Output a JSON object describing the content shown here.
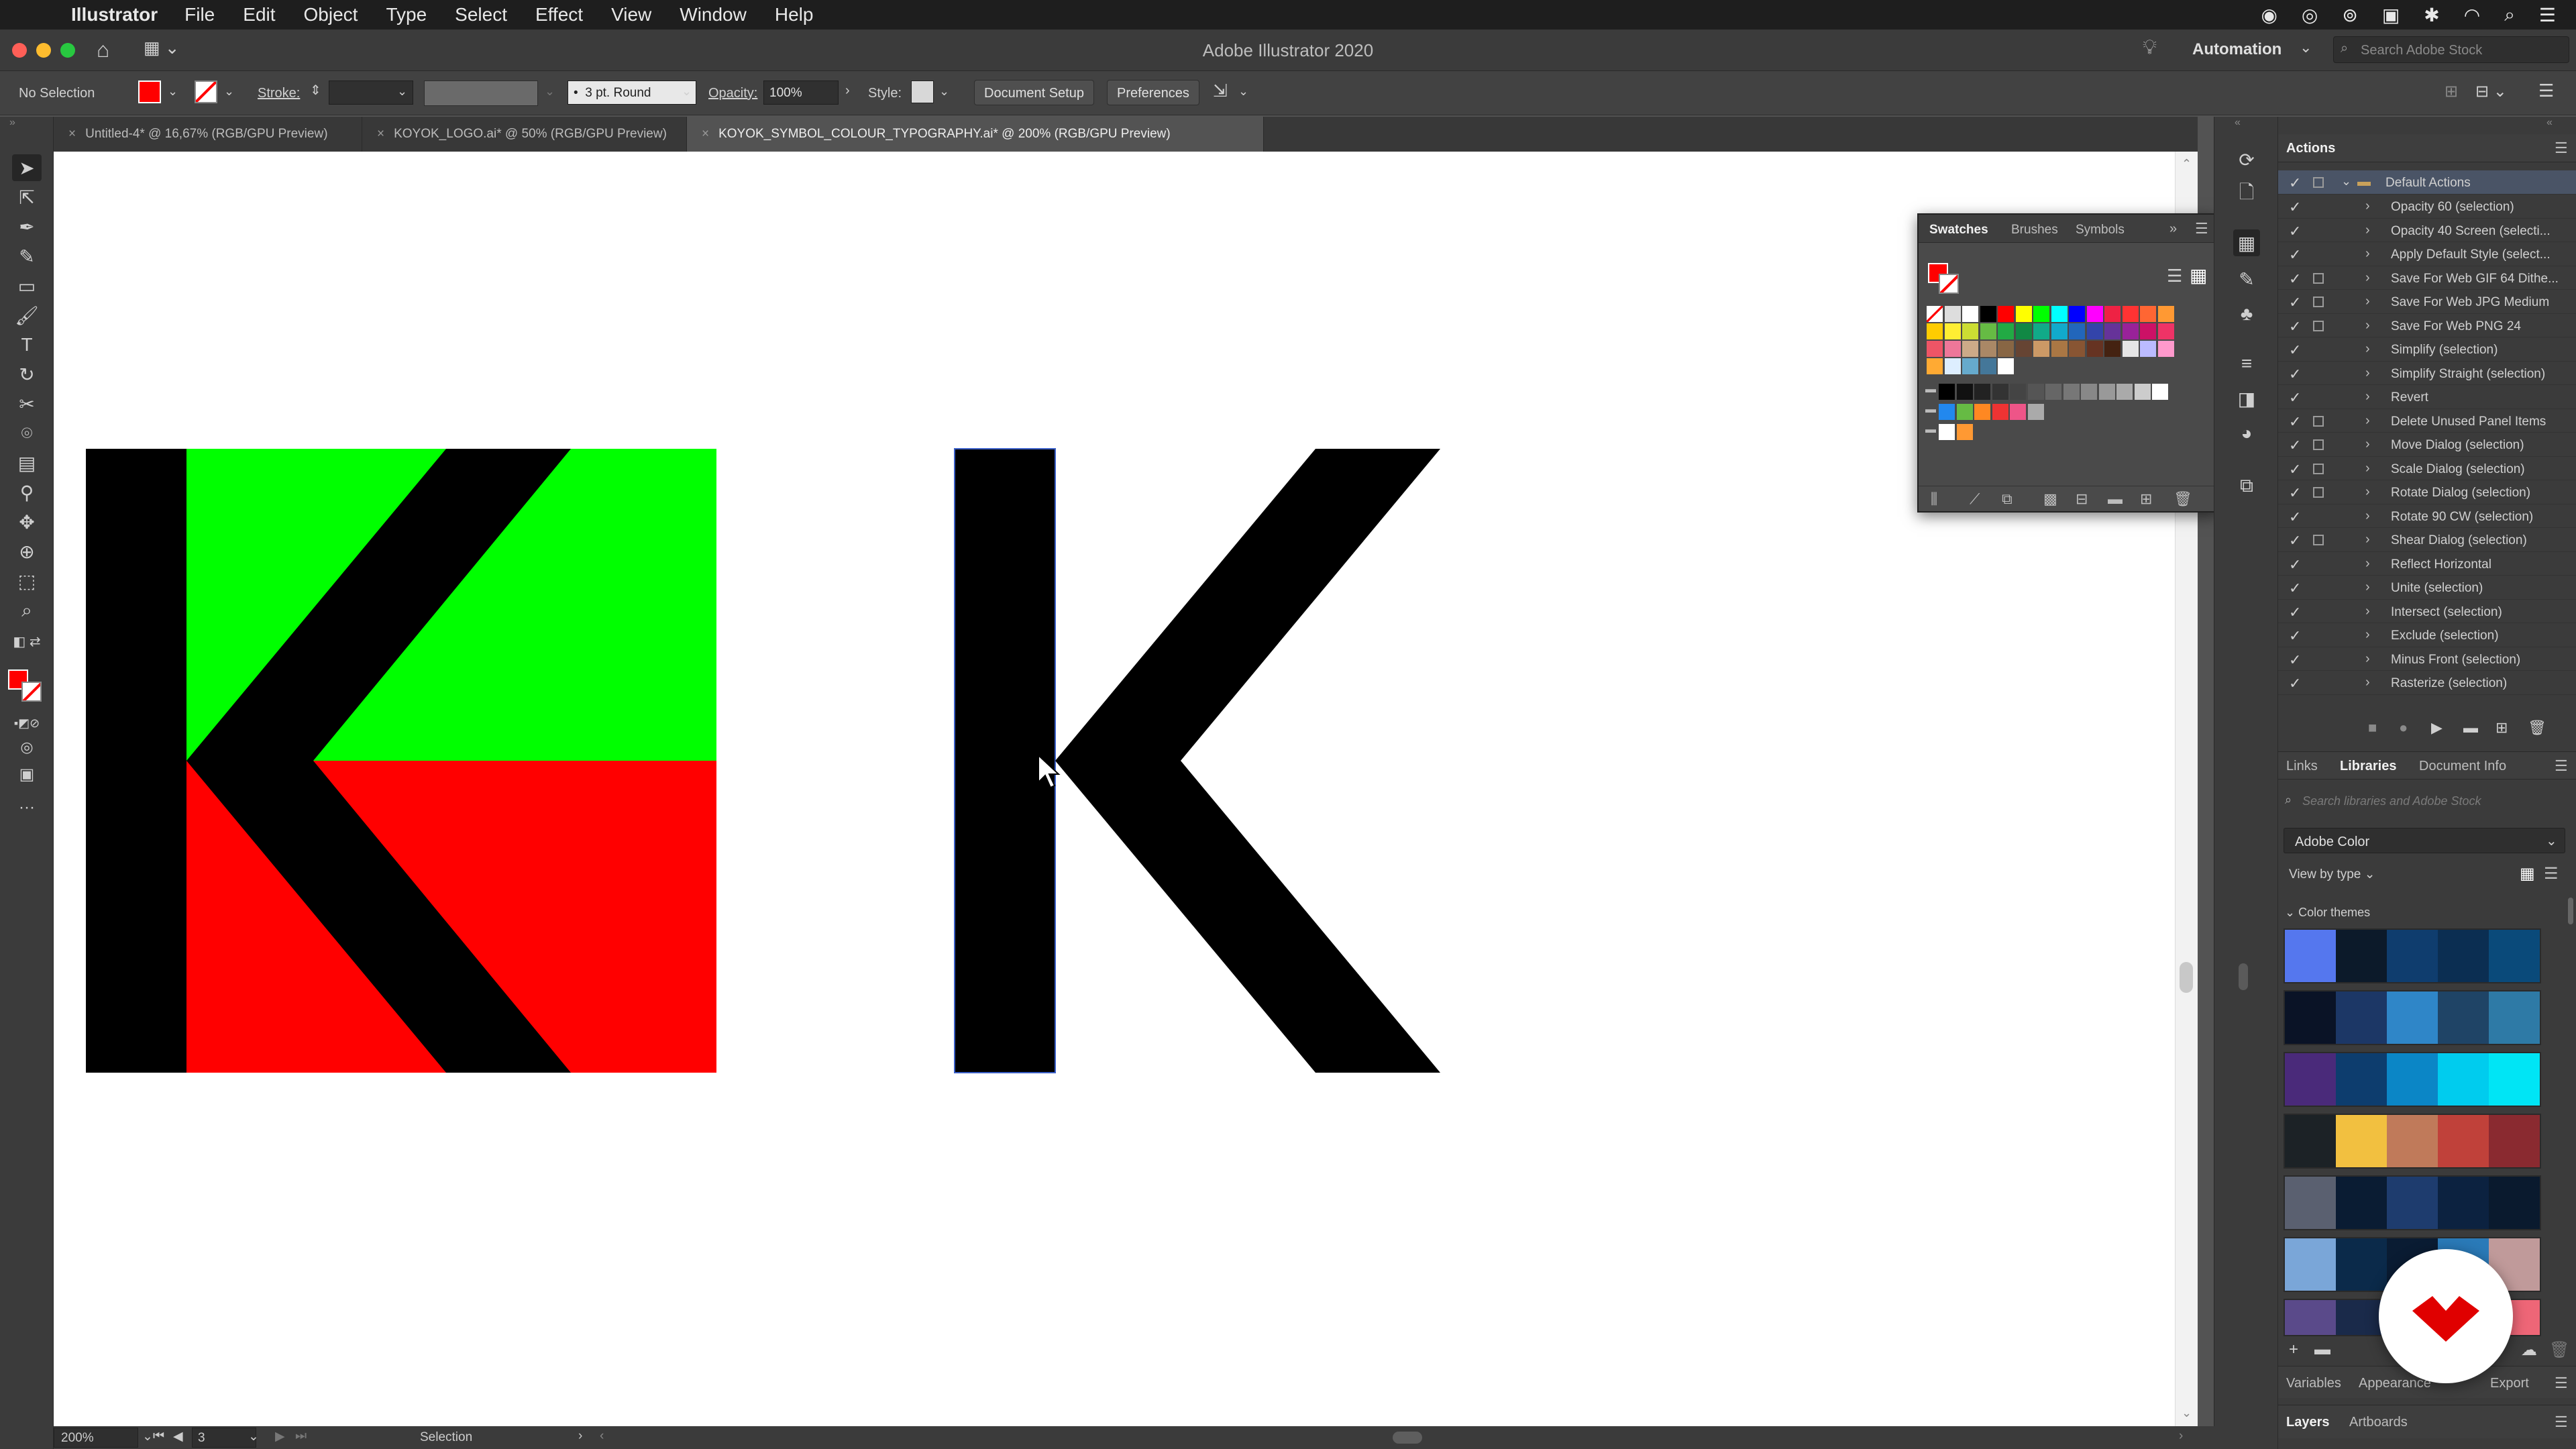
{
  "menubar": {
    "app_name": "Illustrator",
    "items": [
      "File",
      "Edit",
      "Object",
      "Type",
      "Select",
      "Effect",
      "View",
      "Window",
      "Help"
    ]
  },
  "titlebar": {
    "title": "Adobe Illustrator 2020",
    "workspace": "Automation",
    "search_placeholder": "Search Adobe Stock"
  },
  "controlbar": {
    "selection": "No Selection",
    "stroke_label": "Stroke:",
    "brush_value": "3 pt. Round",
    "opacity_label": "Opacity:",
    "opacity_value": "100%",
    "style_label": "Style:",
    "document_setup": "Document Setup",
    "preferences": "Preferences",
    "fill_color": "#ff0000"
  },
  "doc_tabs": [
    {
      "label": "Untitled-4* @ 16,67% (RGB/GPU Preview)"
    },
    {
      "label": "KOYOK_LOGO.ai* @ 50% (RGB/GPU Preview)"
    },
    {
      "label": "KOYOK_SYMBOL_COLOUR_TYPOGRAPHY.ai* @ 200% (RGB/GPU Preview)"
    }
  ],
  "canvas": {
    "colors": {
      "green": "#00ff00",
      "red": "#ff0000",
      "black": "#000000"
    }
  },
  "statusbar": {
    "zoom": "200%",
    "artboard": "3",
    "tool": "Selection"
  },
  "swatches_panel": {
    "tabs": [
      "Swatches",
      "Brushes",
      "Symbols"
    ]
  },
  "actions_panel": {
    "title": "Actions",
    "set_name": "Default Actions",
    "items": [
      "Opacity 60 (selection)",
      "Opacity 40 Screen (selecti...",
      "Apply Default Style (select...",
      "Save For Web GIF 64 Dithe...",
      "Save For Web JPG Medium",
      "Save For Web PNG 24",
      "Simplify (selection)",
      "Simplify Straight (selection)",
      "Revert",
      "Delete Unused Panel Items",
      "Move Dialog (selection)",
      "Scale Dialog (selection)",
      "Rotate Dialog (selection)",
      "Rotate 90 CW (selection)",
      "Shear Dialog (selection)",
      "Reflect Horizontal",
      "Unite (selection)",
      "Intersect (selection)",
      "Exclude (selection)",
      "Minus Front (selection)",
      "Rasterize (selection)"
    ]
  },
  "libraries_panel": {
    "tabs": [
      "Links",
      "Libraries",
      "Document Info"
    ],
    "search_placeholder": "Search libraries and Adobe Stock",
    "library": "Adobe Color",
    "view_by": "View by type",
    "section": "Color themes",
    "themes": [
      [
        "#5577ee",
        "#0c1a2a",
        "#0f3d6e",
        "#0b2e52",
        "#0a4a7a"
      ],
      [
        "#0a1326",
        "#1c3766",
        "#2f86c8",
        "#1f4466",
        "#2e7aa6"
      ],
      [
        "#4a2a7a",
        "#0d3d6e",
        "#0b86c6",
        "#00ccee",
        "#00e5f5"
      ],
      [
        "#1c2226",
        "#f2c040",
        "#c07a5a",
        "#c0413a",
        "#8a2a30"
      ],
      [
        "#5a6070",
        "#0a1c33",
        "#1e3c6e",
        "#0c2240",
        "#0a1a2e"
      ],
      [
        "#7aa6d8",
        "#0b2a4a",
        "#0a1c33",
        "#2a7ab8",
        "#c09a9a"
      ],
      [
        "#5a4a8a",
        "#1a2a4a",
        "#2a3a5a",
        "#ffffff",
        "#ee6677"
      ]
    ]
  },
  "bottom_tabs": {
    "row1": [
      "Variables",
      "Appearance",
      "Export"
    ],
    "row2": [
      "Layers",
      "Artboards"
    ]
  }
}
